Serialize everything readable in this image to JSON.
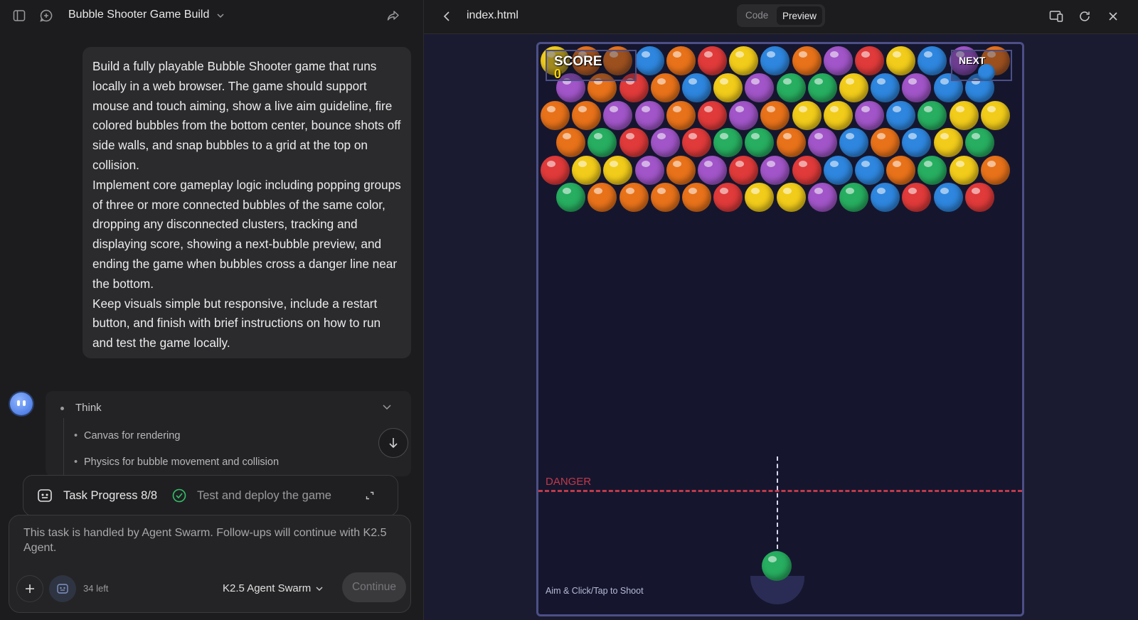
{
  "left_panel": {
    "title": "Bubble Shooter Game Build",
    "user_message": [
      "Build a fully playable Bubble Shooter game that runs locally in a web browser. The game should support mouse and touch aiming, show a live aim guideline, fire colored bubbles from the bottom center, bounce shots off side walls, and snap bubbles to a grid at the top on collision.",
      "Implement core gameplay logic including popping groups of three or more connected bubbles of the same color, dropping any disconnected clusters, tracking and displaying score, showing a next-bubble preview, and ending the game when bubbles cross a danger line near the bottom.",
      "Keep visuals simple but responsive, include a restart button, and finish with brief instructions on how to run and test the game locally."
    ],
    "think": {
      "label": "Think",
      "items": [
        "Canvas for rendering",
        "Physics for bubble movement and collision"
      ]
    },
    "task_progress": {
      "label": "Task Progress 8/8",
      "current_step": "Test and deploy the game"
    },
    "input": {
      "placeholder": "This task is handled by Agent Swarm. Follow-ups will continue with K2.5 Agent.",
      "remaining": "34 left",
      "model": "K2.5 Agent Swarm",
      "continue_label": "Continue"
    }
  },
  "right_panel": {
    "file_name": "index.html",
    "tabs": {
      "code": "Code",
      "preview": "Preview"
    },
    "game": {
      "score_label": "SCORE",
      "score_value": "0",
      "next_label": "NEXT",
      "next_color": "#2e86de",
      "danger_label": "DANGER",
      "hint": "Aim & Click/Tap to Shoot",
      "shooter_color": "#27ae60",
      "palette": {
        "R": "#e03a3a",
        "O": "#e8721a",
        "Y": "#f2cc1a",
        "G": "#27ae60",
        "B": "#2e86de",
        "P": "#a155c8"
      },
      "rows": [
        "YOOBORYBOPRYBPO",
        "POROBYPGGYBPBB",
        "OOPPORPOYYPBGYY",
        "OGRPRGGOPBOBYG",
        "RYYPOPRPRBBOGYO",
        "GOOOORYYPGBRBR"
      ]
    }
  }
}
